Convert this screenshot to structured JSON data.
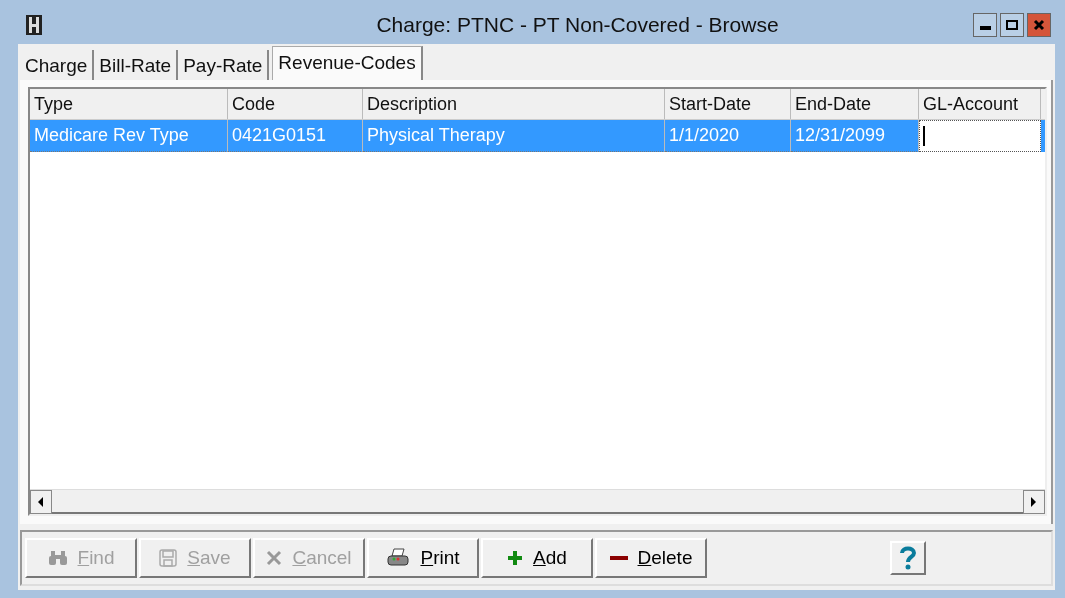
{
  "window": {
    "title": "Charge: PTNC - PT Non-Covered - Browse"
  },
  "tabs": [
    {
      "label": "Charge",
      "selected": false
    },
    {
      "label": "Bill-Rate",
      "selected": false
    },
    {
      "label": "Pay-Rate",
      "selected": false
    },
    {
      "label": "Revenue-Codes",
      "selected": true
    }
  ],
  "table": {
    "columns": [
      "Type",
      "Code",
      "Description",
      "Start-Date",
      "End-Date",
      "GL-Account"
    ],
    "rows": [
      {
        "cells": [
          "Medicare Rev Type",
          "0421G0151",
          "Physical Therapy",
          "1/1/2020",
          "12/31/2099"
        ],
        "selected": true,
        "editing_last_cell": true
      }
    ]
  },
  "buttons": [
    {
      "label": "Find",
      "kind": "find",
      "disabled": true
    },
    {
      "label": "Save",
      "kind": "save",
      "disabled": true
    },
    {
      "label": "Cancel",
      "kind": "cancel",
      "disabled": true
    },
    {
      "label": "Print",
      "kind": "print",
      "disabled": false
    },
    {
      "label": "Add",
      "kind": "add",
      "disabled": false
    },
    {
      "label": "Delete",
      "kind": "delete",
      "disabled": false
    }
  ]
}
